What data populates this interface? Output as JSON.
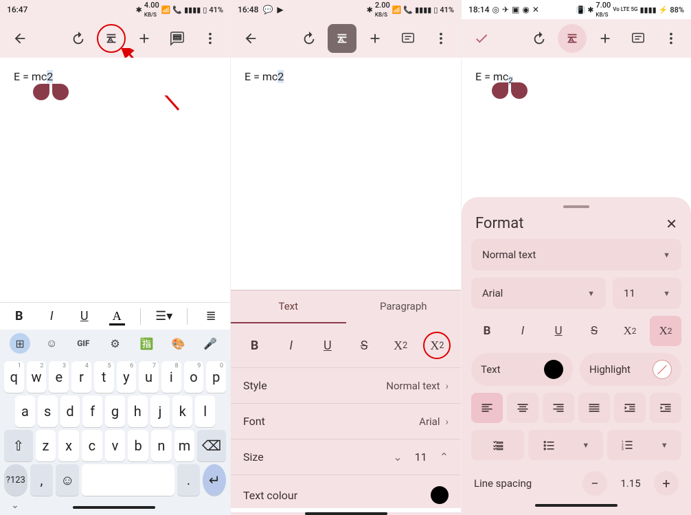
{
  "panel1": {
    "status": {
      "time": "16:47",
      "net": "4.00",
      "netUnit": "KB/S",
      "battery": "41%"
    },
    "doc": {
      "text": "E = mc",
      "sel": "2"
    }
  },
  "panel2": {
    "status": {
      "time": "16:48",
      "net": "2.00",
      "netUnit": "KB/S",
      "battery": "41%"
    },
    "doc": {
      "text": "E = mc",
      "sel": "2"
    },
    "tabs": {
      "text": "Text",
      "paragraph": "Paragraph"
    },
    "style": {
      "label": "Style",
      "value": "Normal text"
    },
    "font": {
      "label": "Font",
      "value": "Arial"
    },
    "size": {
      "label": "Size",
      "value": "11"
    },
    "textcolour": {
      "label": "Text colour"
    }
  },
  "panel3": {
    "status": {
      "time": "18:14",
      "net": "7.00",
      "netUnit": "KB/S",
      "netExtra": "Vo LTE 5G",
      "battery": "88%"
    },
    "doc": {
      "text": "E = mc",
      "sub": "2"
    },
    "title": "Format",
    "style": "Normal text",
    "font": "Arial",
    "size": "11",
    "textLabel": "Text",
    "highlightLabel": "Highlight",
    "lineSpacing": {
      "label": "Line spacing",
      "value": "1.15"
    }
  }
}
